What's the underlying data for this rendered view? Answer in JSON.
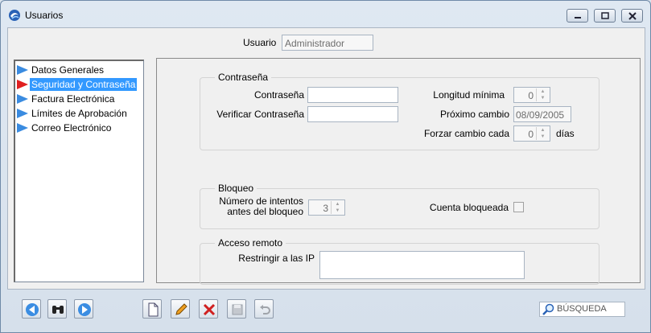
{
  "window": {
    "title": "Usuarios"
  },
  "user": {
    "label": "Usuario",
    "value": "Administrador"
  },
  "sidebar": {
    "items": [
      {
        "label": "Datos Generales"
      },
      {
        "label": "Seguridad y Contraseña",
        "selected": true
      },
      {
        "label": "Factura Electrónica"
      },
      {
        "label": "Límites de Aprobación"
      },
      {
        "label": "Correo Electrónico"
      }
    ]
  },
  "password_group": {
    "title": "Contraseña",
    "password_label": "Contraseña",
    "password_value": "",
    "verify_label": "Verificar Contraseña",
    "verify_value": "",
    "min_length_label": "Longitud mínima",
    "min_length_value": "0",
    "next_change_label": "Próximo cambio",
    "next_change_value": "08/09/2005",
    "force_change_label": "Forzar cambio cada",
    "force_change_value": "0",
    "days_label": "días"
  },
  "lock_group": {
    "title": "Bloqueo",
    "attempts_label_line1": "Número de intentos",
    "attempts_label_line2": "antes del bloqueo",
    "attempts_value": "3",
    "locked_label": "Cuenta bloqueada",
    "locked_checked": false
  },
  "remote_group": {
    "title": "Acceso remoto",
    "restrict_ip_label": "Restringir a las IP",
    "restrict_ip_value": ""
  },
  "toolbar": {
    "search_label": "BÚSQUEDA"
  },
  "colors": {
    "selection": "#3399ff",
    "nav_arrow": "#3a8be0",
    "nav_arrow_selected": "#e02020",
    "delete_x": "#d02020"
  }
}
